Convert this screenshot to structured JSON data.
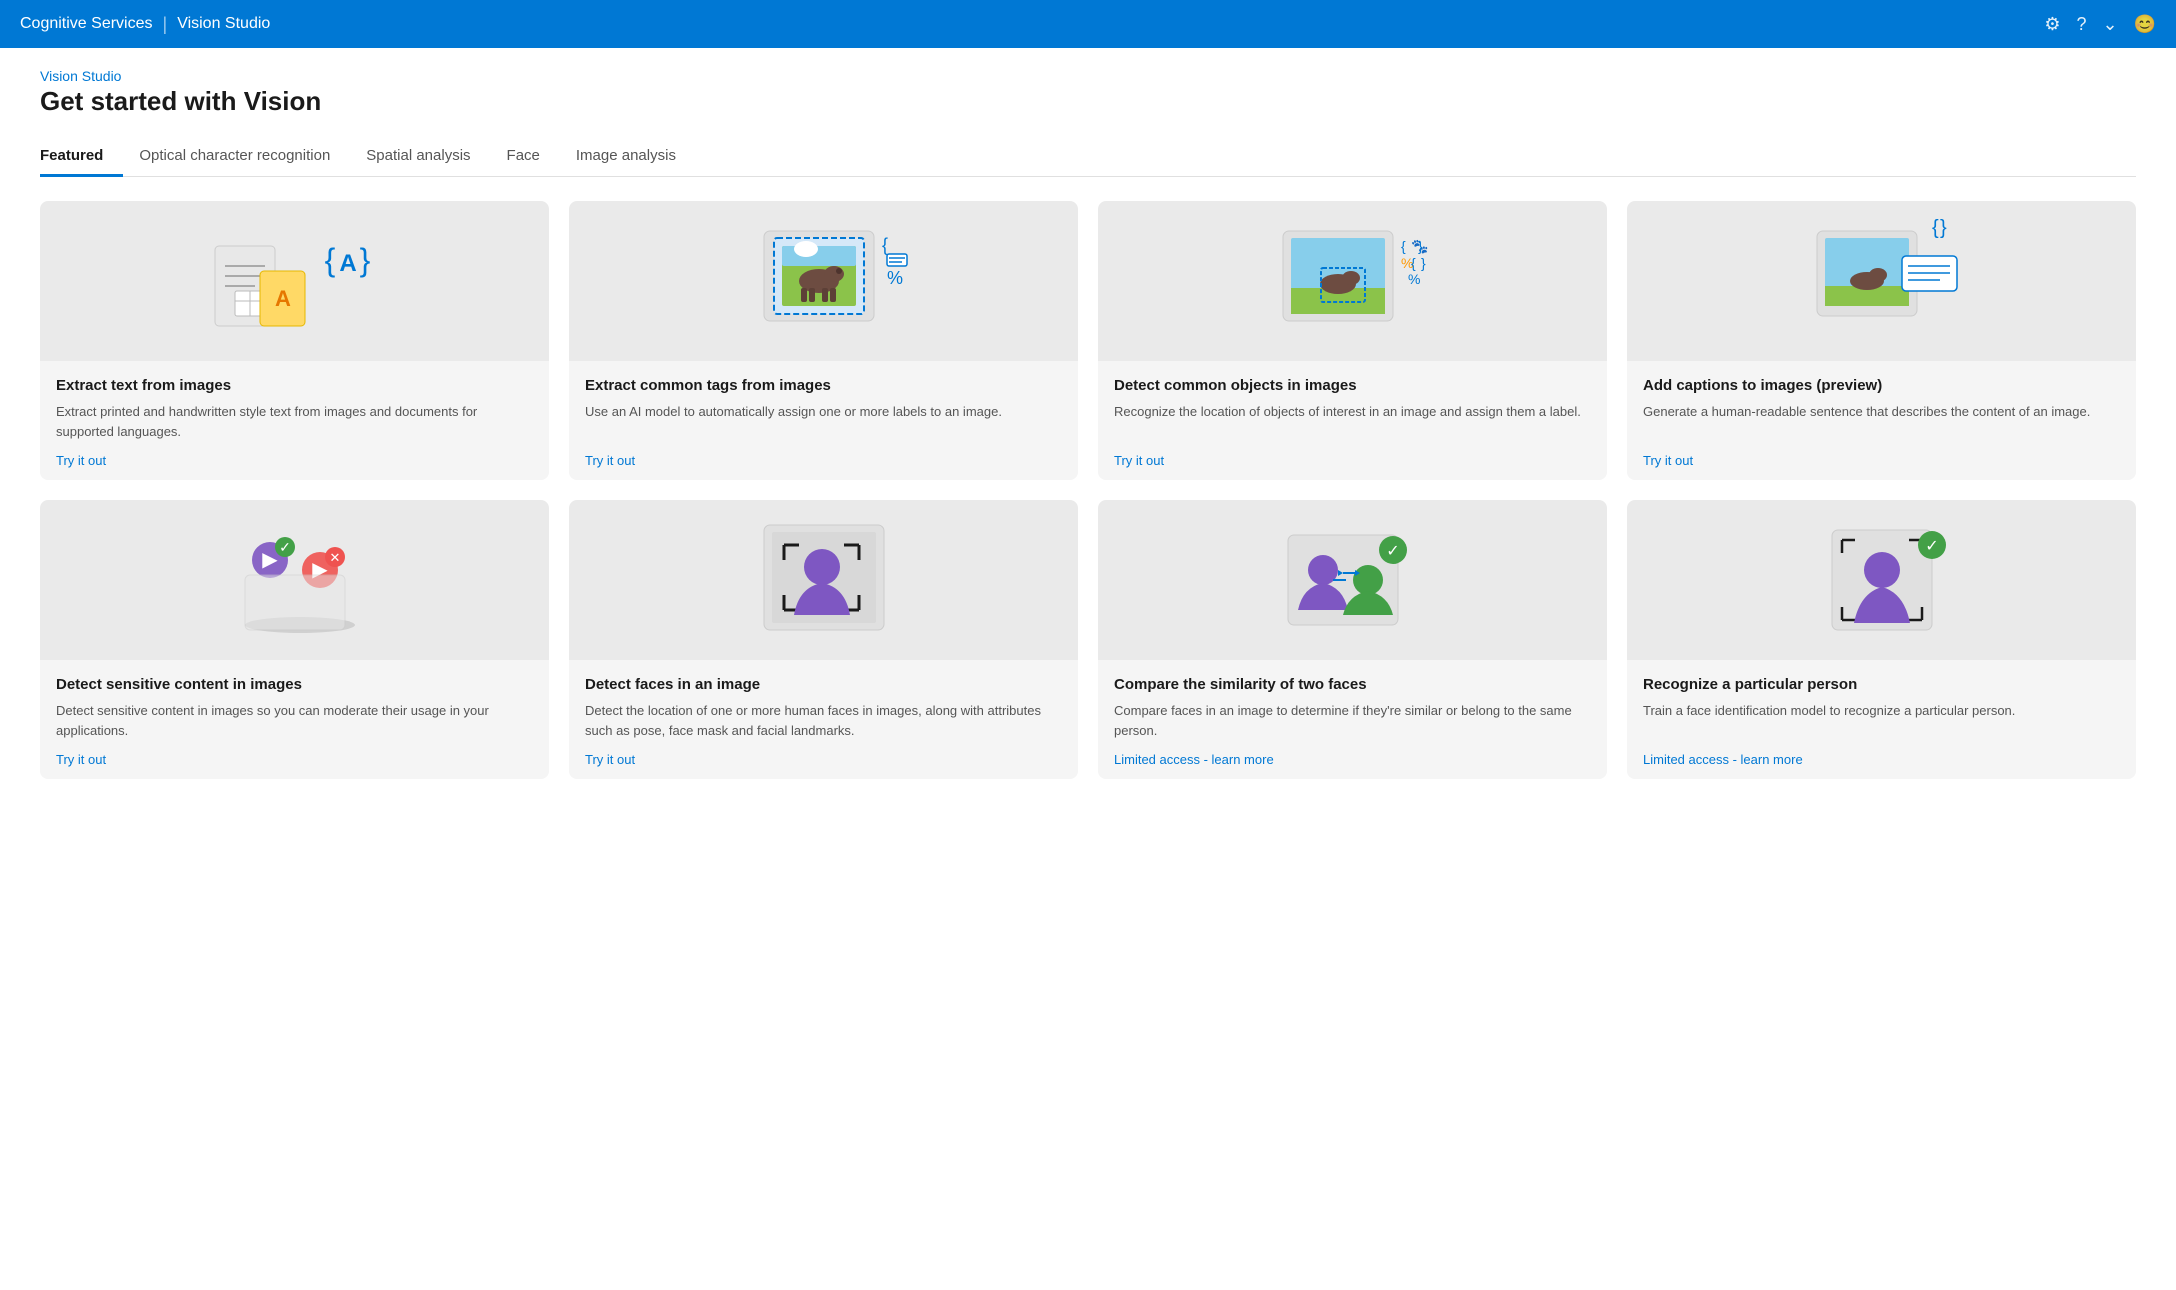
{
  "header": {
    "brand": "Cognitive Services",
    "divider": "|",
    "app": "Vision Studio",
    "icons": [
      "gear",
      "help",
      "chevron-down",
      "user"
    ]
  },
  "breadcrumb": "Vision Studio",
  "page_title": "Get started with Vision",
  "tabs": [
    {
      "id": "featured",
      "label": "Featured",
      "active": true
    },
    {
      "id": "ocr",
      "label": "Optical character recognition",
      "active": false
    },
    {
      "id": "spatial",
      "label": "Spatial analysis",
      "active": false
    },
    {
      "id": "face",
      "label": "Face",
      "active": false
    },
    {
      "id": "image",
      "label": "Image analysis",
      "active": false
    }
  ],
  "cards_row1": [
    {
      "id": "extract-text",
      "title": "Extract text from images",
      "desc": "Extract printed and handwritten style text from images and documents for supported languages.",
      "link_label": "Try it out",
      "link_type": "try"
    },
    {
      "id": "extract-tags",
      "title": "Extract common tags from images",
      "desc": "Use an AI model to automatically assign one or more labels to an image.",
      "link_label": "Try it out",
      "link_type": "try"
    },
    {
      "id": "detect-objects",
      "title": "Detect common objects in images",
      "desc": "Recognize the location of objects of interest in an image and assign them a label.",
      "link_label": "Try it out",
      "link_type": "try"
    },
    {
      "id": "add-captions",
      "title": "Add captions to images (preview)",
      "desc": "Generate a human-readable sentence that describes the content of an image.",
      "link_label": "Try it out",
      "link_type": "try"
    }
  ],
  "cards_row2": [
    {
      "id": "sensitive-content",
      "title": "Detect sensitive content in images",
      "desc": "Detect sensitive content in images so you can moderate their usage in your applications.",
      "link_label": "Try it out",
      "link_type": "try"
    },
    {
      "id": "detect-faces",
      "title": "Detect faces in an image",
      "desc": "Detect the location of one or more human faces in images, along with attributes such as pose, face mask and facial landmarks.",
      "link_label": "Try it out",
      "link_type": "try"
    },
    {
      "id": "compare-faces",
      "title": "Compare the similarity of two faces",
      "desc": "Compare faces in an image to determine if they're similar or belong to the same person.",
      "link_label": "Limited access - learn more",
      "link_type": "limited"
    },
    {
      "id": "recognize-person",
      "title": "Recognize a particular person",
      "desc": "Train a face identification model to recognize a particular person.",
      "link_label": "Limited access - learn more",
      "link_type": "limited"
    }
  ]
}
